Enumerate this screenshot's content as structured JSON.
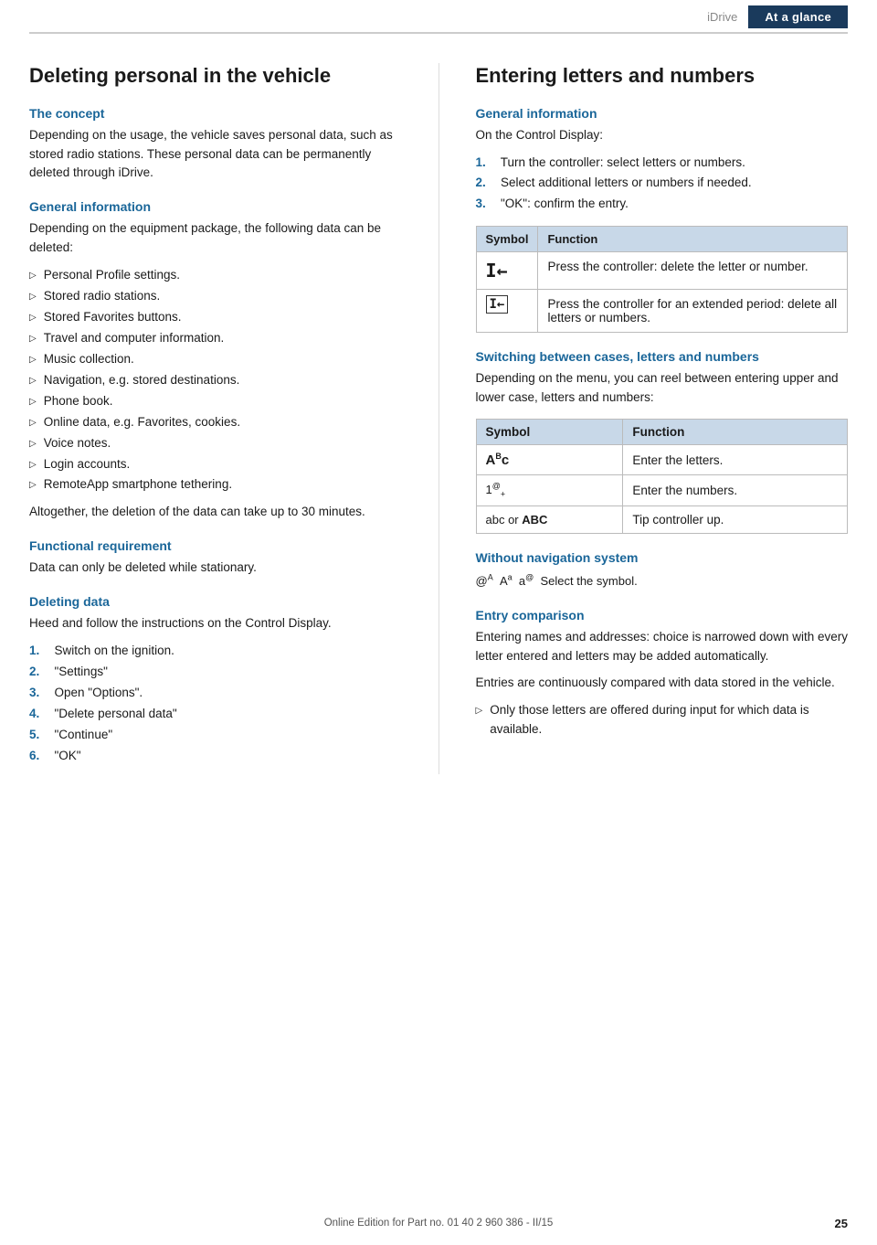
{
  "header": {
    "brand": "iDrive",
    "tab": "At a glance"
  },
  "left": {
    "main_title": "Deleting personal in the vehicle",
    "sections": [
      {
        "id": "the-concept",
        "title": "The concept",
        "paragraphs": [
          "Depending on the usage, the vehicle saves personal data, such as stored radio stations. These personal data can be permanently deleted through iDrive."
        ]
      },
      {
        "id": "general-information",
        "title": "General information",
        "paragraphs": [
          "Depending on the equipment package, the following data can be deleted:"
        ],
        "bullets": [
          "Personal Profile settings.",
          "Stored radio stations.",
          "Stored Favorites buttons.",
          "Travel and computer information.",
          "Music collection.",
          "Navigation, e.g. stored destinations.",
          "Phone book.",
          "Online data, e.g. Favorites, cookies.",
          "Voice notes.",
          "Login accounts.",
          "RemoteApp smartphone tethering."
        ],
        "after_bullets": "Altogether, the deletion of the data can take up to 30 minutes."
      },
      {
        "id": "functional-requirement",
        "title": "Functional requirement",
        "paragraphs": [
          "Data can only be deleted while stationary."
        ]
      },
      {
        "id": "deleting-data",
        "title": "Deleting data",
        "paragraphs": [
          "Heed and follow the instructions on the Control Display."
        ],
        "steps": [
          "Switch on the ignition.",
          "\"Settings\"",
          "Open \"Options\".",
          "\"Delete personal data\"",
          "\"Continue\"",
          "\"OK\""
        ]
      }
    ]
  },
  "right": {
    "main_title": "Entering letters and numbers",
    "sections": [
      {
        "id": "general-info-right",
        "title": "General information",
        "paragraphs": [
          "On the Control Display:"
        ],
        "steps": [
          "Turn the controller: select letters or numbers.",
          "Select additional letters or numbers if needed.",
          "\"OK\": confirm the entry."
        ],
        "table": {
          "headers": [
            "Symbol",
            "Function"
          ],
          "rows": [
            {
              "symbol": "I←",
              "function": "Press the controller: delete the letter or number."
            },
            {
              "symbol": "I←",
              "function": "Press the controller for an extended period: delete all letters or numbers."
            }
          ]
        }
      },
      {
        "id": "switching-cases",
        "title": "Switching between cases, letters and numbers",
        "paragraphs": [
          "Depending on the menu, you can reel between entering upper and lower case, letters and numbers:"
        ],
        "table": {
          "headers": [
            "Symbol",
            "Function"
          ],
          "rows": [
            {
              "symbol": "Aᴬc",
              "function": "Enter the letters."
            },
            {
              "symbol": "1®₊",
              "function": "Enter the numbers."
            },
            {
              "symbol": "abc or ABC",
              "function": "Tip controller up."
            }
          ]
        }
      },
      {
        "id": "without-nav",
        "title": "Without navigation system",
        "symbols_line": "@ᴬ  Aᵃ  a®  Select the symbol."
      },
      {
        "id": "entry-comparison",
        "title": "Entry comparison",
        "paragraphs": [
          "Entering names and addresses: choice is narrowed down with every letter entered and letters may be added automatically.",
          "Entries are continuously compared with data stored in the vehicle."
        ],
        "bullets": [
          "Only those letters are offered during input for which data is available."
        ]
      }
    ]
  },
  "footer": {
    "text": "Online Edition for Part no. 01 40 2 960 386 - II/15",
    "page": "25"
  }
}
